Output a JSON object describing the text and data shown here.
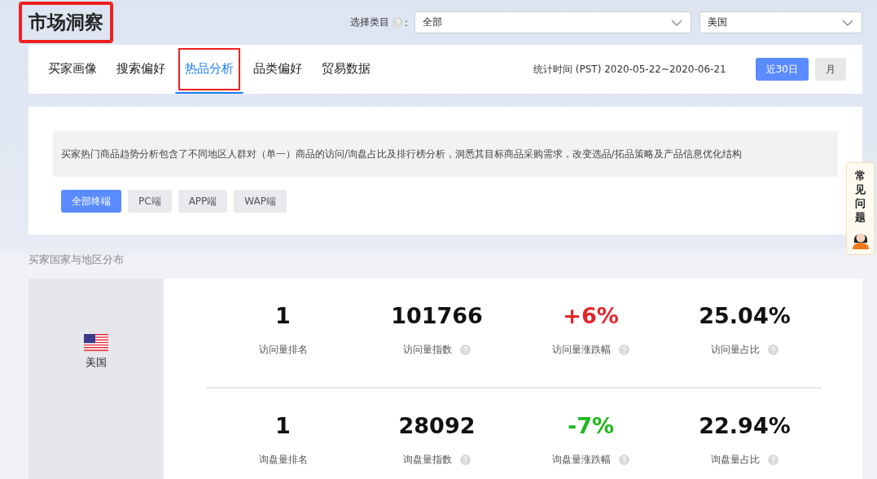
{
  "header": {
    "title": "市场洞察",
    "title_highlighted": true,
    "category_label": "选择类目",
    "category_colon": ":",
    "category_select": {
      "value": "全部"
    },
    "country_select": {
      "value": "美国"
    }
  },
  "tabs": [
    {
      "label": "买家画像",
      "selected": false,
      "highlighted": false
    },
    {
      "label": "搜索偏好",
      "selected": false,
      "highlighted": false
    },
    {
      "label": "热品分析",
      "selected": true,
      "highlighted": true
    },
    {
      "label": "品类偏好",
      "selected": false,
      "highlighted": false
    },
    {
      "label": "贸易数据",
      "selected": false,
      "highlighted": false
    }
  ],
  "stat_period": "统计时间 (PST) 2020-05-22~2020-06-21",
  "period_buttons": [
    {
      "label": "近30日",
      "selected": true
    },
    {
      "label": "月",
      "selected": false
    }
  ],
  "description": "买家热门商品趋势分析包含了不同地区人群对（单一）商品的访问/询盘占比及排行榜分析，洞悉其目标商品采购需求，改变选品/拓品策略及产品信息优化结构",
  "terminals": [
    {
      "label": "全部终端",
      "selected": true
    },
    {
      "label": "PC端",
      "selected": false
    },
    {
      "label": "APP端",
      "selected": false
    },
    {
      "label": "WAP端",
      "selected": false
    }
  ],
  "section_title": "买家国家与地区分布",
  "region": {
    "name": "美国"
  },
  "metric_rows": [
    {
      "metrics": [
        {
          "value": "1",
          "label": "访问量排名",
          "color": "#111111",
          "help": false
        },
        {
          "value": "101766",
          "label": "访问量指数",
          "color": "#111111",
          "help": true
        },
        {
          "value": "+6%",
          "label": "访问量涨跌幅",
          "color": "#e3252b",
          "help": true
        },
        {
          "value": "25.04%",
          "label": "访问量占比",
          "color": "#111111",
          "help": true
        }
      ]
    },
    {
      "metrics": [
        {
          "value": "1",
          "label": "询盘量排名",
          "color": "#111111",
          "help": false
        },
        {
          "value": "28092",
          "label": "询盘量指数",
          "color": "#111111",
          "help": true
        },
        {
          "value": "-7%",
          "label": "询盘量涨跌幅",
          "color": "#1dba1d",
          "help": true
        },
        {
          "value": "22.94%",
          "label": "询盘量占比",
          "color": "#111111",
          "help": true
        }
      ]
    }
  ],
  "help_widget": {
    "label": "常见问题"
  }
}
